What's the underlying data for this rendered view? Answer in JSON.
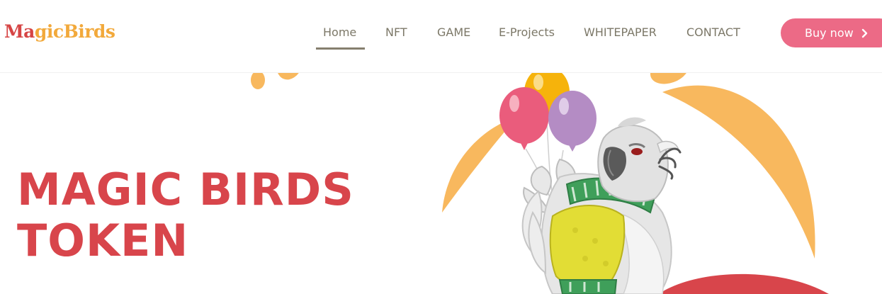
{
  "header": {
    "logo": {
      "part_a": "Ma",
      "part_b": "gicBirds"
    },
    "nav": [
      {
        "label": "Home",
        "active": true
      },
      {
        "label": "NFT"
      },
      {
        "label": "GAME"
      },
      {
        "label": "E-Projects"
      },
      {
        "label": "WHITEPAPER"
      },
      {
        "label": "CONTACT"
      }
    ],
    "cta": {
      "label": "Buy now",
      "icon": "chevron-right-icon"
    }
  },
  "hero": {
    "title_line1": "MAGIC BIRDS",
    "title_line2": "TOKEN"
  },
  "illustration": {
    "subject": "parrot-with-balloons",
    "balloon_colors": [
      "#f6b30b",
      "#ea5c7c",
      "#b48cc4"
    ]
  },
  "colors": {
    "accent_red": "#d8454b",
    "accent_orange": "#f8b85e",
    "cta_pink": "#ec6a86",
    "nav_text": "#7c7868"
  }
}
